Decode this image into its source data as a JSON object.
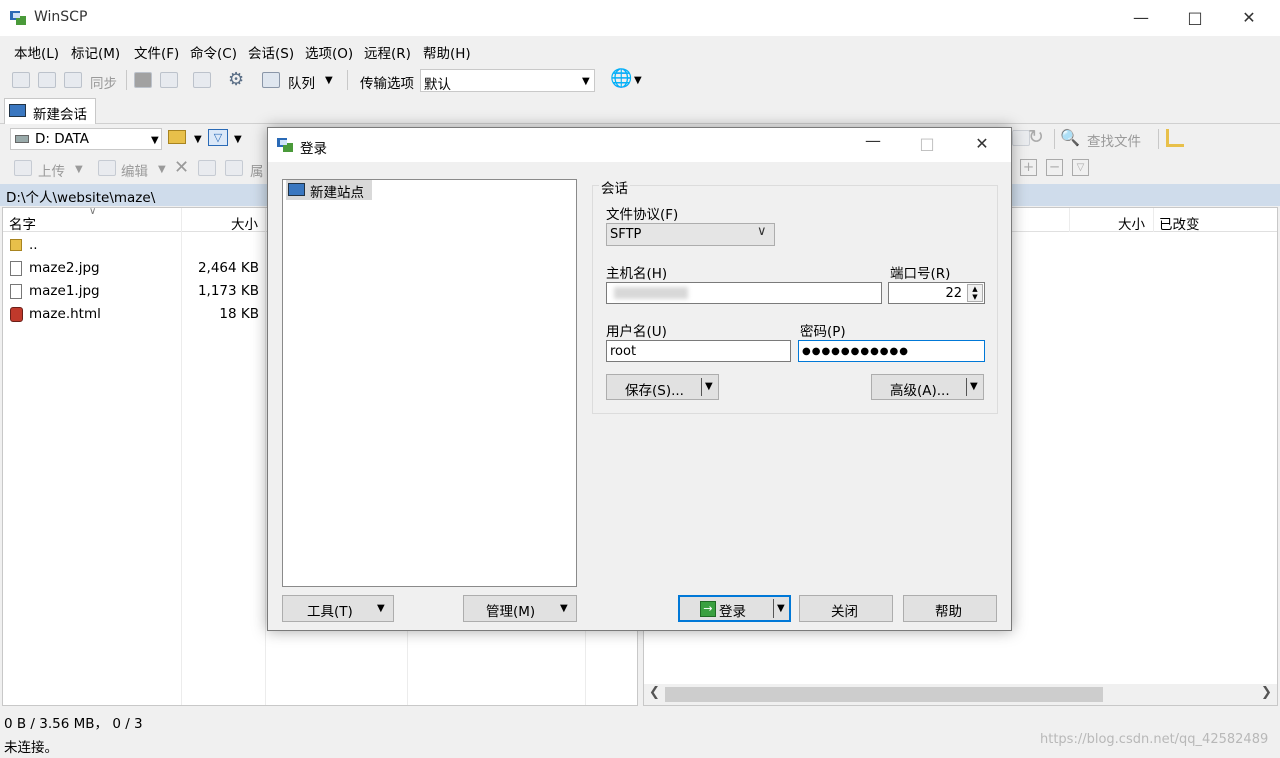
{
  "app": {
    "title": "WinSCP"
  },
  "menu": [
    "本地(L)",
    "标记(M)",
    "文件(F)",
    "命令(C)",
    "会话(S)",
    "选项(O)",
    "远程(R)",
    "帮助(H)"
  ],
  "toolbar": {
    "sync": "同步",
    "queue": "队列",
    "transfer_label": "传输选项",
    "transfer_value": "默认"
  },
  "tabs": {
    "new_session": "新建会话"
  },
  "left_panel": {
    "drive": "D: DATA",
    "upload": "上传",
    "edit": "编辑",
    "props_partial": "属",
    "path": "D:\\个人\\website\\maze\\",
    "columns": {
      "name": "名字",
      "size": "大小"
    },
    "files": [
      {
        "name": "..",
        "size": ""
      },
      {
        "name": "maze2.jpg",
        "size": "2,464 KB"
      },
      {
        "name": "maze1.jpg",
        "size": "1,173 KB"
      },
      {
        "name": "maze.html",
        "size": "18 KB"
      }
    ],
    "status": "0 B / 3.56 MB，  0 / 3"
  },
  "right_panel": {
    "find_files": "查找文件",
    "columns": {
      "size": "大小",
      "changed": "已改变"
    }
  },
  "statusbar": {
    "text": "未连接。",
    "watermark": "https://blog.csdn.net/qq_42582489"
  },
  "dialog": {
    "title": "登录",
    "site": "新建站点",
    "group_label": "会话",
    "protocol_label": "文件协议(F)",
    "protocol_value": "SFTP",
    "host_label": "主机名(H)",
    "host_value": "",
    "port_label": "端口号(R)",
    "port_value": "22",
    "user_label": "用户名(U)",
    "user_value": "root",
    "password_label": "密码(P)",
    "password_value": "●●●●●●●●●●●",
    "save_button": "保存(S)...",
    "advanced_button": "高级(A)...",
    "tools_button": "工具(T)",
    "manage_button": "管理(M)",
    "login_button": "登录",
    "close_button": "关闭",
    "help_button": "帮助"
  }
}
